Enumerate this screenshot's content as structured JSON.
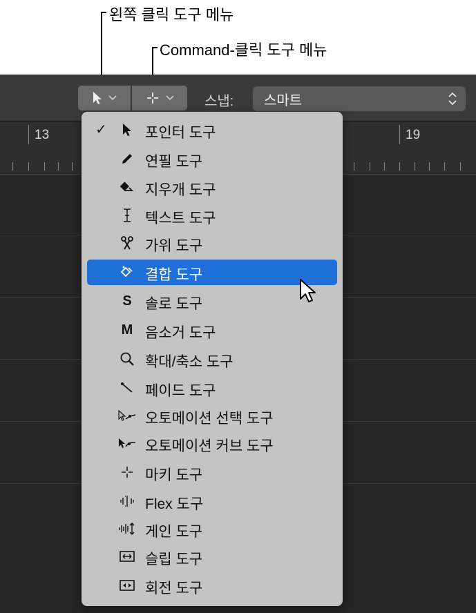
{
  "callouts": {
    "left_menu": "왼쪽 클릭 도구 메뉴",
    "command_menu": "Command-클릭 도구 메뉴"
  },
  "toolbar": {
    "left_tool_icon": "pointer-icon",
    "command_tool_icon": "marquee-crosshair-icon",
    "snap_label": "스냅:",
    "snap_value": "스마트"
  },
  "ruler": {
    "bar_left": "13",
    "bar_right": "19"
  },
  "menu": {
    "items": [
      {
        "label": "포인터 도구",
        "icon": "pointer-icon",
        "checked": true
      },
      {
        "label": "연필 도구",
        "icon": "pencil-icon"
      },
      {
        "label": "지우개 도구",
        "icon": "eraser-icon"
      },
      {
        "label": "텍스트 도구",
        "icon": "text-cursor-icon"
      },
      {
        "label": "가위 도구",
        "icon": "scissors-icon"
      },
      {
        "label": "결합 도구",
        "icon": "glue-icon",
        "highlighted": true
      },
      {
        "label": "솔로 도구",
        "icon": "S"
      },
      {
        "label": "음소거 도구",
        "icon": "M"
      },
      {
        "label": "확대/축소 도구",
        "icon": "zoom-icon"
      },
      {
        "label": "페이드 도구",
        "icon": "fade-icon"
      },
      {
        "label": "오토메이션 선택 도구",
        "icon": "automation-select-icon"
      },
      {
        "label": "오토메이션 커브 도구",
        "icon": "automation-curve-icon"
      },
      {
        "label": "마키 도구",
        "icon": "marquee-crosshair-icon"
      },
      {
        "label": "Flex 도구",
        "icon": "flex-icon"
      },
      {
        "label": "게인 도구",
        "icon": "gain-icon"
      },
      {
        "label": "슬립 도구",
        "icon": "slip-icon"
      },
      {
        "label": "회전 도구",
        "icon": "rotate-icon"
      }
    ],
    "colors": {
      "background": "#c4c4c4",
      "highlight": "#1f6fd6"
    }
  }
}
